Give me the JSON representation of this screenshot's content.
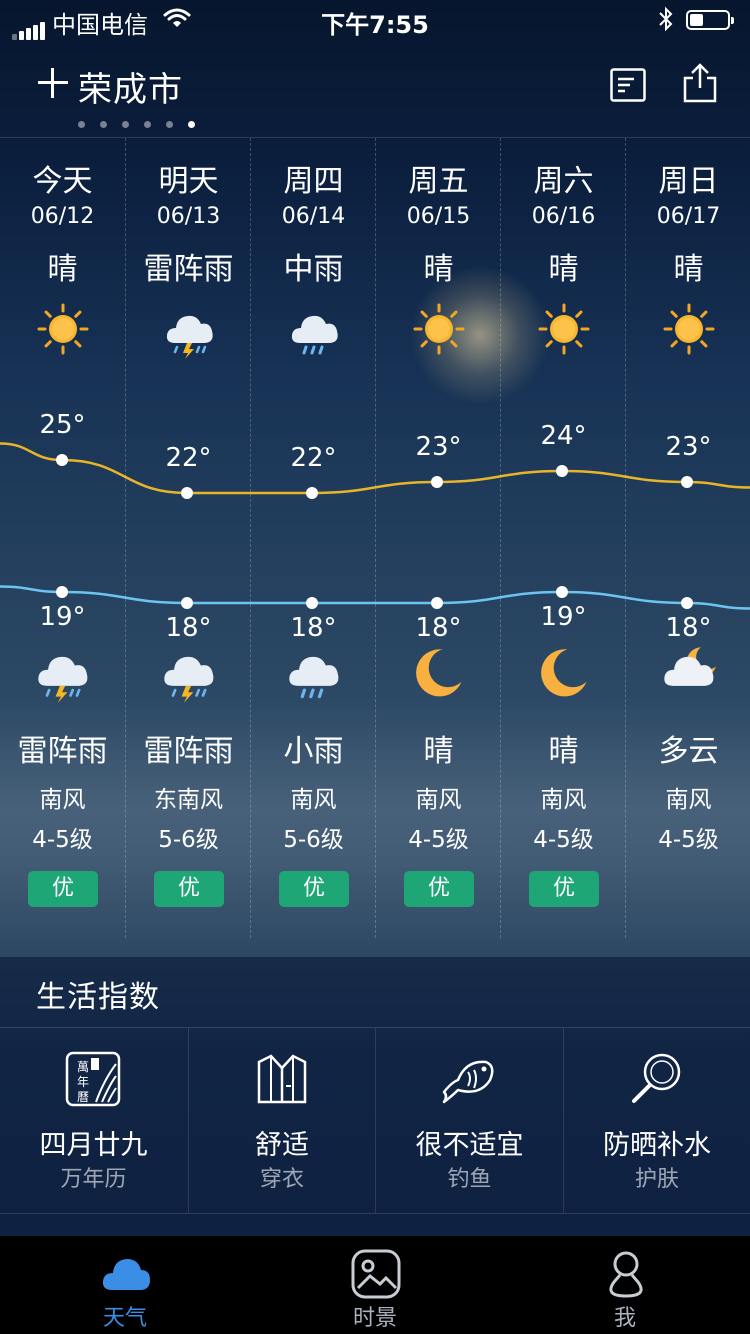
{
  "status_bar": {
    "carrier": "中国电信",
    "time": "下午7:55"
  },
  "header": {
    "city": "荣成市",
    "page_dots": 6,
    "active_dot": 5
  },
  "forecast": {
    "days": [
      {
        "day": "今天",
        "date": "06/12",
        "day_condition": "晴",
        "day_icon": "sun-icon",
        "high": "25°",
        "low": "19°",
        "night_icon": "thunderstorm-icon",
        "night_condition": "雷阵雨",
        "wind_direction": "南风",
        "wind_level": "4-5级",
        "aqi": "优"
      },
      {
        "day": "明天",
        "date": "06/13",
        "day_condition": "雷阵雨",
        "day_icon": "thunderstorm-icon",
        "high": "22°",
        "low": "18°",
        "night_icon": "thunderstorm-icon",
        "night_condition": "雷阵雨",
        "wind_direction": "东南风",
        "wind_level": "5-6级",
        "aqi": "优"
      },
      {
        "day": "周四",
        "date": "06/14",
        "day_condition": "中雨",
        "day_icon": "rain-icon",
        "high": "22°",
        "low": "18°",
        "night_icon": "rain-icon",
        "night_condition": "小雨",
        "wind_direction": "南风",
        "wind_level": "5-6级",
        "aqi": "优"
      },
      {
        "day": "周五",
        "date": "06/15",
        "day_condition": "晴",
        "day_icon": "sun-icon",
        "high": "23°",
        "low": "18°",
        "night_icon": "moon-icon",
        "night_condition": "晴",
        "wind_direction": "南风",
        "wind_level": "4-5级",
        "aqi": "优"
      },
      {
        "day": "周六",
        "date": "06/16",
        "day_condition": "晴",
        "day_icon": "sun-icon",
        "high": "24°",
        "low": "19°",
        "night_icon": "moon-icon",
        "night_condition": "晴",
        "wind_direction": "南风",
        "wind_level": "4-5级",
        "aqi": "优"
      },
      {
        "day": "周日",
        "date": "06/17",
        "day_condition": "晴",
        "day_icon": "sun-icon",
        "high": "23°",
        "low": "18°",
        "night_icon": "cloudy-night-icon",
        "night_condition": "多云",
        "wind_direction": "南风",
        "wind_level": "4-5级",
        "aqi": ""
      }
    ],
    "high_line_color": "#e8b528",
    "low_line_color": "#6cc4f0"
  },
  "life_index": {
    "title": "生活指数",
    "items": [
      {
        "icon": "almanac-icon",
        "value": "四月廿九",
        "label": "万年历"
      },
      {
        "icon": "shirt-icon",
        "value": "舒适",
        "label": "穿衣"
      },
      {
        "icon": "fish-icon",
        "value": "很不适宜",
        "label": "钓鱼"
      },
      {
        "icon": "magnifier-icon",
        "value": "防晒补水",
        "label": "护肤"
      }
    ]
  },
  "tab_bar": {
    "tabs": [
      {
        "icon": "cloud-icon",
        "label": "天气",
        "active": true
      },
      {
        "icon": "picture-icon",
        "label": "时景",
        "active": false
      },
      {
        "icon": "person-icon",
        "label": "我",
        "active": false
      }
    ],
    "active_color": "#3a8ee6"
  },
  "almanac_icon_text": "萬年曆"
}
